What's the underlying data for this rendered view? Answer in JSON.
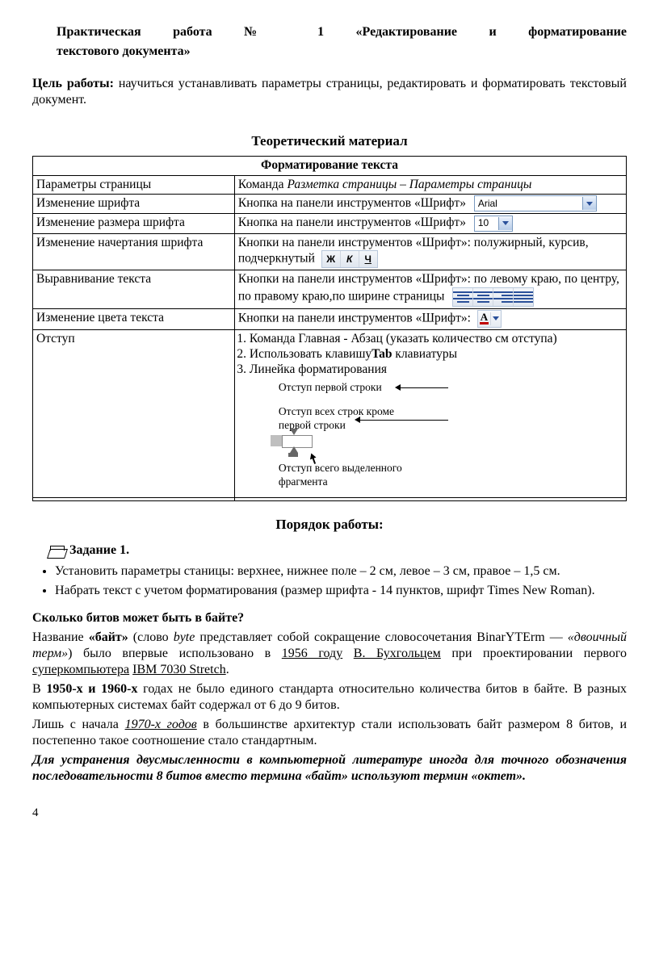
{
  "title_line1": "Практическая работа № 1 «Редактирование и форматирование",
  "title_line2": "текстового документа»",
  "goal_label": "Цель работы:",
  "goal_text": " научиться устанавливать параметры страницы, редактировать и форматировать текстовый документ.",
  "theory_heading": "Теоретический материал",
  "table_header": "Форматирование текста",
  "rows": {
    "r1c1": "Параметры страницы",
    "r1c2a": "Команда ",
    "r1c2b": "Разметка страницы – Параметры страницы",
    "r2c1": "Изменение шрифта",
    "r2c2": "Кнопка на панели инструментов «Шрифт»",
    "font_dd": "Arial",
    "r3c1": "Изменение размера шрифта",
    "r3c2": "Кнопка на панели инструментов «Шрифт»",
    "size_dd": "10",
    "r4c1": "Изменение начертания шрифта",
    "r4c2a": "Кнопки на панели инструментов «Шрифт»: полужирный, курсив, подчеркнутый",
    "b": "Ж",
    "i": "К",
    "u": "Ч",
    "r5c1": "Выравнивание текста",
    "r5c2": "Кнопки на панели инструментов «Шрифт»: по левому краю, по центру, по правому краю,по ширине страницы",
    "r6c1": "Изменение цвета текста",
    "r6c2": "Кнопки на панели инструментов «Шрифт»:",
    "A": "А",
    "r7c1": "Отступ",
    "r7li1": "Команда Главная - Абзац (указать количество см отступа)",
    "r7li2_a": "Использовать клавишу",
    "r7li2_b": "Tab",
    "r7li2_c": " клавиатуры",
    "r7li3": "Линейка форматирования",
    "rc1": "Отступ первой строки",
    "rc2": "Отступ всех строк кроме первой строки",
    "rc3": "Отступ всего выделенного фрагмента"
  },
  "order_heading": "Порядок работы:",
  "task1": "Задание 1.",
  "bul1": "Установить параметры станицы: верхнее, нижнее поле – 2 см, левое – 3 см, правое – 1,5 см.",
  "bul2": "Набрать текст с учетом форматирования (размер шрифта - 14 пунктов, шрифт Times New Roman).",
  "subheading": "Сколько битов может быть в байте?",
  "p1a": "Название ",
  "p1b": "«байт»",
  "p1c": " (слово ",
  "p1d": "byte",
  "p1e": " представляет собой сокращение словосочетания BinarYTErm — ",
  "p1f": "«двоичный терм»",
  "p1g": ") было впервые использовано в ",
  "p1h": "1956 году",
  "p1i": " ",
  "p1j": "В. Бухгольцем",
  "p1k": " при проектировании первого ",
  "p1l": "суперкомпьютера",
  "p1m": " ",
  "p1n": "IBM 7030 Stretch",
  "p1o": ".",
  "p2a": "В ",
  "p2b": "1950-х и 1960-х",
  "p2c": " годах не было единого стандарта относительно количества битов в байте. В разных компьютерных системах байт содержал от 6 до 9 битов.",
  "p3a": "Лишь с начала ",
  "p3b": "1970-х годов",
  "p3c": " в большинстве архитектур стали использовать байт размером 8 битов, и постепенно такое соотношение стало стандартным.",
  "p4": "Для устранения двусмысленности в компьютерной литературе иногда для точного обозначения последовательности 8 битов вместо термина «байт» используют термин «октет».",
  "pagenum": "4"
}
